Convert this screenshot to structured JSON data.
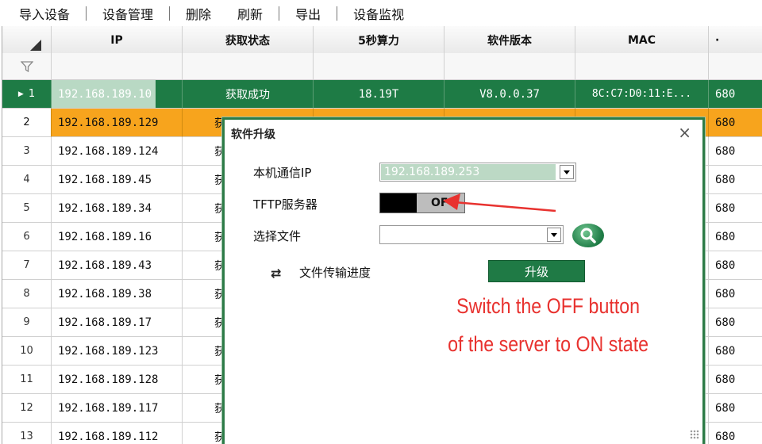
{
  "toolbar": {
    "import": "导入设备",
    "manage": "设备管理",
    "delete": "删除",
    "refresh": "刷新",
    "export": "导出",
    "monitor": "设备监视"
  },
  "table": {
    "headers": [
      "IP",
      "获取状态",
      "5秒算力",
      "软件版本",
      "MAC",
      "·"
    ],
    "selected_row": {
      "num": "1",
      "ip": "192.168.189.10",
      "status": "获取成功",
      "hashrate": "18.19T",
      "version": "V8.0.0.37",
      "mac": "8C:C7:D0:11:E...",
      "extra": "680"
    },
    "rows": [
      {
        "num": "2",
        "ip": "192.168.189.129",
        "status": "获",
        "extra": "680"
      },
      {
        "num": "3",
        "ip": "192.168.189.124",
        "status": "获",
        "extra": "680"
      },
      {
        "num": "4",
        "ip": "192.168.189.45",
        "status": "获",
        "extra": "680"
      },
      {
        "num": "5",
        "ip": "192.168.189.34",
        "status": "获",
        "extra": "680"
      },
      {
        "num": "6",
        "ip": "192.168.189.16",
        "status": "获",
        "extra": "680"
      },
      {
        "num": "7",
        "ip": "192.168.189.43",
        "status": "获",
        "extra": "680"
      },
      {
        "num": "8",
        "ip": "192.168.189.38",
        "status": "获",
        "extra": "680"
      },
      {
        "num": "9",
        "ip": "192.168.189.17",
        "status": "获",
        "extra": "680"
      },
      {
        "num": "10",
        "ip": "192.168.189.123",
        "status": "获",
        "extra": "680"
      },
      {
        "num": "11",
        "ip": "192.168.189.128",
        "status": "获",
        "extra": "680"
      },
      {
        "num": "12",
        "ip": "192.168.189.117",
        "status": "获",
        "extra": "680"
      },
      {
        "num": "13",
        "ip": "192.168.189.112",
        "status": "获",
        "extra": "680"
      }
    ]
  },
  "dialog": {
    "title": "软件升级",
    "close": "×",
    "ip_label": "本机通信IP",
    "ip_value": "192.168.189.253",
    "tftp_label": "TFTP服务器",
    "tftp_state": "OF",
    "file_label": "选择文件",
    "file_value": "",
    "progress_label": "文件传输进度",
    "upgrade_button": "升级"
  },
  "annotation": {
    "line1": "Switch the OFF button",
    "line2": "of the server to ON state",
    "color": "#e8322f"
  },
  "colors": {
    "accent": "#1e7b45",
    "highlight_row": "#f7a41d"
  }
}
